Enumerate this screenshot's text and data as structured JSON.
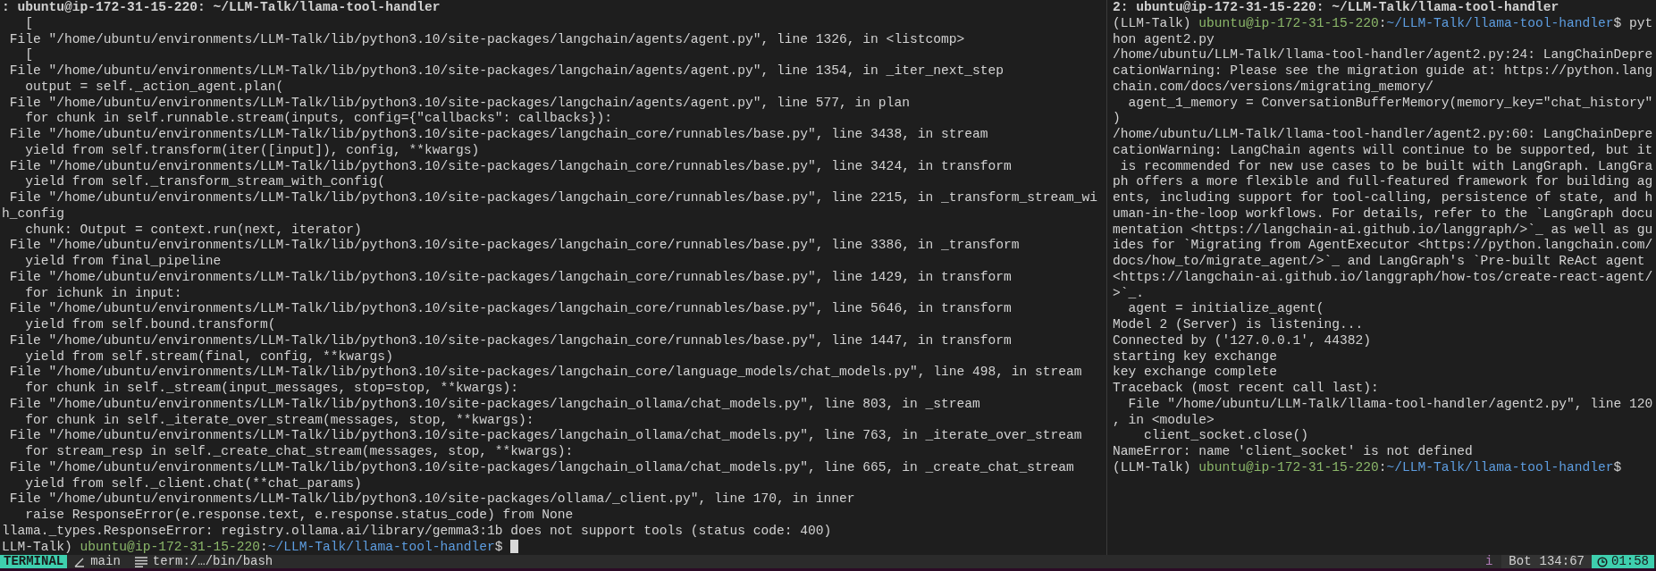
{
  "panes": [
    {
      "title": ": ubuntu@ip-172-31-15-220: ~/LLM-Talk/llama-tool-handler",
      "cursor": true,
      "lines": [
        {
          "kind": "output",
          "text": "   ["
        },
        {
          "kind": "output",
          "text": " File \"/home/ubuntu/environments/LLM-Talk/lib/python3.10/site-packages/langchain/agents/agent.py\", line 1326, in <listcomp>"
        },
        {
          "kind": "output",
          "text": "   ["
        },
        {
          "kind": "output",
          "text": " File \"/home/ubuntu/environments/LLM-Talk/lib/python3.10/site-packages/langchain/agents/agent.py\", line 1354, in _iter_next_step"
        },
        {
          "kind": "output",
          "text": "   output = self._action_agent.plan("
        },
        {
          "kind": "output",
          "text": " File \"/home/ubuntu/environments/LLM-Talk/lib/python3.10/site-packages/langchain/agents/agent.py\", line 577, in plan"
        },
        {
          "kind": "output",
          "text": "   for chunk in self.runnable.stream(inputs, config={\"callbacks\": callbacks}):"
        },
        {
          "kind": "output",
          "text": " File \"/home/ubuntu/environments/LLM-Talk/lib/python3.10/site-packages/langchain_core/runnables/base.py\", line 3438, in stream"
        },
        {
          "kind": "output",
          "text": "   yield from self.transform(iter([input]), config, **kwargs)"
        },
        {
          "kind": "output",
          "text": " File \"/home/ubuntu/environments/LLM-Talk/lib/python3.10/site-packages/langchain_core/runnables/base.py\", line 3424, in transform"
        },
        {
          "kind": "output",
          "text": "   yield from self._transform_stream_with_config("
        },
        {
          "kind": "output",
          "text": " File \"/home/ubuntu/environments/LLM-Talk/lib/python3.10/site-packages/langchain_core/runnables/base.py\", line 2215, in _transform_stream_wi"
        },
        {
          "kind": "output",
          "text": "h_config"
        },
        {
          "kind": "output",
          "text": "   chunk: Output = context.run(next, iterator)"
        },
        {
          "kind": "output",
          "text": " File \"/home/ubuntu/environments/LLM-Talk/lib/python3.10/site-packages/langchain_core/runnables/base.py\", line 3386, in _transform"
        },
        {
          "kind": "output",
          "text": "   yield from final_pipeline"
        },
        {
          "kind": "output",
          "text": " File \"/home/ubuntu/environments/LLM-Talk/lib/python3.10/site-packages/langchain_core/runnables/base.py\", line 1429, in transform"
        },
        {
          "kind": "output",
          "text": "   for ichunk in input:"
        },
        {
          "kind": "output",
          "text": " File \"/home/ubuntu/environments/LLM-Talk/lib/python3.10/site-packages/langchain_core/runnables/base.py\", line 5646, in transform"
        },
        {
          "kind": "output",
          "text": "   yield from self.bound.transform("
        },
        {
          "kind": "output",
          "text": " File \"/home/ubuntu/environments/LLM-Talk/lib/python3.10/site-packages/langchain_core/runnables/base.py\", line 1447, in transform"
        },
        {
          "kind": "output",
          "text": "   yield from self.stream(final, config, **kwargs)"
        },
        {
          "kind": "output",
          "text": " File \"/home/ubuntu/environments/LLM-Talk/lib/python3.10/site-packages/langchain_core/language_models/chat_models.py\", line 498, in stream"
        },
        {
          "kind": "output",
          "text": "   for chunk in self._stream(input_messages, stop=stop, **kwargs):"
        },
        {
          "kind": "output",
          "text": " File \"/home/ubuntu/environments/LLM-Talk/lib/python3.10/site-packages/langchain_ollama/chat_models.py\", line 803, in _stream"
        },
        {
          "kind": "output",
          "text": "   for chunk in self._iterate_over_stream(messages, stop, **kwargs):"
        },
        {
          "kind": "output",
          "text": " File \"/home/ubuntu/environments/LLM-Talk/lib/python3.10/site-packages/langchain_ollama/chat_models.py\", line 763, in _iterate_over_stream"
        },
        {
          "kind": "output",
          "text": "   for stream_resp in self._create_chat_stream(messages, stop, **kwargs):"
        },
        {
          "kind": "output",
          "text": " File \"/home/ubuntu/environments/LLM-Talk/lib/python3.10/site-packages/langchain_ollama/chat_models.py\", line 665, in _create_chat_stream"
        },
        {
          "kind": "output",
          "text": "   yield from self._client.chat(**chat_params)"
        },
        {
          "kind": "output",
          "text": " File \"/home/ubuntu/environments/LLM-Talk/lib/python3.10/site-packages/ollama/_client.py\", line 170, in inner"
        },
        {
          "kind": "output",
          "text": "   raise ResponseError(e.response.text, e.response.status_code) from None"
        },
        {
          "kind": "output",
          "text": "llama._types.ResponseError: registry.ollama.ai/library/gemma3:1b does not support tools (status code: 400)"
        },
        {
          "kind": "prompt",
          "parts": [
            {
              "kind": "plain",
              "text": "LLM-Talk) "
            },
            {
              "kind": "host",
              "text": "ubuntu@ip-172-31-15-220"
            },
            {
              "kind": "plain",
              "text": ":"
            },
            {
              "kind": "path",
              "text": "~/LLM-Talk/llama-tool-handler"
            },
            {
              "kind": "plain",
              "text": "$ "
            }
          ]
        }
      ]
    },
    {
      "title": "2: ubuntu@ip-172-31-15-220: ~/LLM-Talk/llama-tool-handler",
      "cursor": false,
      "lines": [
        {
          "kind": "prompt",
          "parts": [
            {
              "kind": "plain",
              "text": "(LLM-Talk) "
            },
            {
              "kind": "host",
              "text": "ubuntu@ip-172-31-15-220"
            },
            {
              "kind": "plain",
              "text": ":"
            },
            {
              "kind": "path",
              "text": "~/LLM-Talk/llama-tool-handler"
            },
            {
              "kind": "plain",
              "text": "$ pyt"
            }
          ]
        },
        {
          "kind": "output",
          "text": "hon agent2.py"
        },
        {
          "kind": "output",
          "text": "/home/ubuntu/LLM-Talk/llama-tool-handler/agent2.py:24: LangChainDepre"
        },
        {
          "kind": "output",
          "text": "cationWarning: Please see the migration guide at: https://python.lang"
        },
        {
          "kind": "output",
          "text": "chain.com/docs/versions/migrating_memory/"
        },
        {
          "kind": "output",
          "text": "  agent_1_memory = ConversationBufferMemory(memory_key=\"chat_history\""
        },
        {
          "kind": "output",
          "text": ")"
        },
        {
          "kind": "output",
          "text": "/home/ubuntu/LLM-Talk/llama-tool-handler/agent2.py:60: LangChainDepre"
        },
        {
          "kind": "output",
          "text": "cationWarning: LangChain agents will continue to be supported, but it"
        },
        {
          "kind": "output",
          "text": " is recommended for new use cases to be built with LangGraph. LangGra"
        },
        {
          "kind": "output",
          "text": "ph offers a more flexible and full-featured framework for building ag"
        },
        {
          "kind": "output",
          "text": "ents, including support for tool-calling, persistence of state, and h"
        },
        {
          "kind": "output",
          "text": "uman-in-the-loop workflows. For details, refer to the `LangGraph docu"
        },
        {
          "kind": "output",
          "text": "mentation <https://langchain-ai.github.io/langgraph/>`_ as well as gu"
        },
        {
          "kind": "output",
          "text": "ides for `Migrating from AgentExecutor <https://python.langchain.com/"
        },
        {
          "kind": "output",
          "text": "docs/how_to/migrate_agent/>`_ and LangGraph's `Pre-built ReAct agent"
        },
        {
          "kind": "output",
          "text": "<https://langchain-ai.github.io/langgraph/how-tos/create-react-agent/"
        },
        {
          "kind": "output",
          "text": ">`_."
        },
        {
          "kind": "output",
          "text": "  agent = initialize_agent("
        },
        {
          "kind": "output",
          "text": "Model 2 (Server) is listening..."
        },
        {
          "kind": "output",
          "text": "Connected by ('127.0.0.1', 44382)"
        },
        {
          "kind": "output",
          "text": "starting key exchange"
        },
        {
          "kind": "output",
          "text": "key exchange complete"
        },
        {
          "kind": "output",
          "text": "Traceback (most recent call last):"
        },
        {
          "kind": "output",
          "text": "  File \"/home/ubuntu/LLM-Talk/llama-tool-handler/agent2.py\", line 120"
        },
        {
          "kind": "output",
          "text": ", in <module>"
        },
        {
          "kind": "output",
          "text": "    client_socket.close()"
        },
        {
          "kind": "output",
          "text": "NameError: name 'client_socket' is not defined"
        },
        {
          "kind": "prompt",
          "parts": [
            {
              "kind": "plain",
              "text": "(LLM-Talk) "
            },
            {
              "kind": "host",
              "text": "ubuntu@ip-172-31-15-220"
            },
            {
              "kind": "plain",
              "text": ":"
            },
            {
              "kind": "path",
              "text": "~/LLM-Talk/llama-tool-handler"
            },
            {
              "kind": "plain",
              "text": "$"
            }
          ]
        }
      ]
    }
  ],
  "status_bar": {
    "mode": "TERMINAL",
    "branch": "main",
    "file": "term:/…/bin/bash",
    "indicator": "i",
    "scroll": "Bot",
    "position": "134:67",
    "time": "01:58"
  }
}
